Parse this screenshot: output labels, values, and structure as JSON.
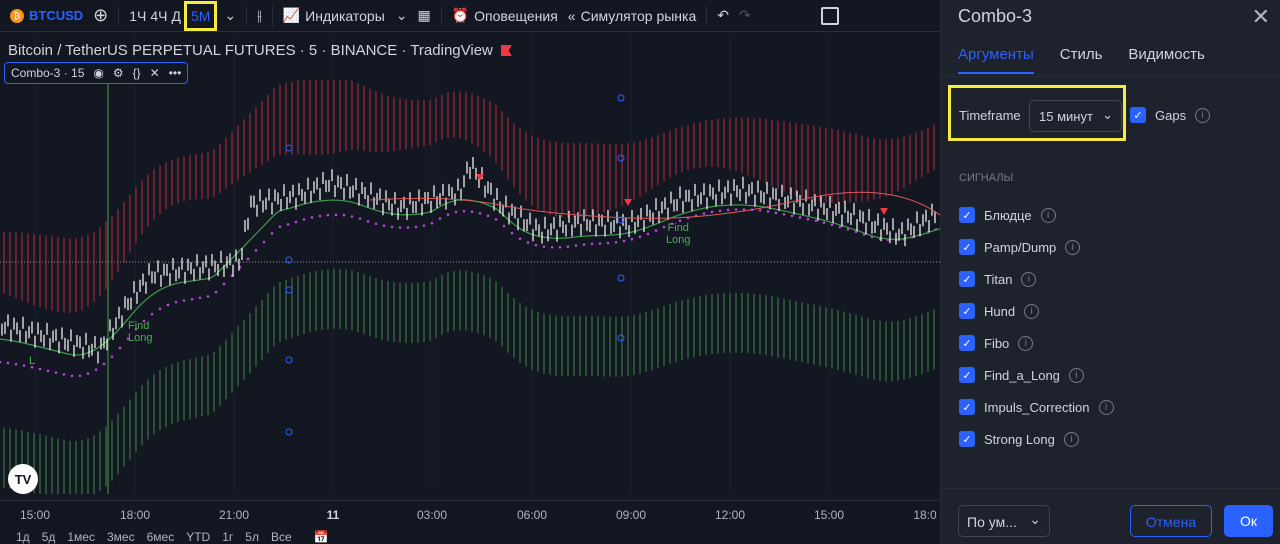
{
  "toolbar": {
    "symbol": "BTCUSD",
    "intervals": [
      "1Ч",
      "4Ч",
      "Д"
    ],
    "active_interval": "5M",
    "indicators": "Индикаторы",
    "alerts": "Оповещения",
    "replay": "Симулятор рынка"
  },
  "chart": {
    "title": "Bitcoin / TetherUS PERPETUAL FUTURES · 5 · BINANCE · TradingView",
    "indicator": "Combo-3 · 15",
    "labels": {
      "find_long_1": "Find",
      "find_long_2": "Long",
      "l": "L"
    },
    "time_axis": [
      "15:00",
      "18:00",
      "21:00",
      "11",
      "03:00",
      "06:00",
      "09:00",
      "12:00",
      "15:00",
      "18:0"
    ],
    "ranges": [
      "1д",
      "5д",
      "1мес",
      "3мес",
      "6мес",
      "YTD",
      "1г",
      "5л",
      "Все"
    ],
    "logo": "TV"
  },
  "panel": {
    "title": "Combo-3",
    "tabs": [
      "Аргументы",
      "Стиль",
      "Видимость"
    ],
    "timeframe_label": "Timeframe",
    "timeframe_value": "15 минут",
    "gaps": "Gaps",
    "section": "СИГНАЛЫ",
    "signals": [
      "Блюдце",
      "Pamp/Dump",
      "Titan",
      "Hund",
      "Fibo",
      "Find_a_Long",
      "Impuls_Correction",
      "Strong Long"
    ],
    "default": "По ум...",
    "cancel": "Отмена",
    "ok": "Ок"
  }
}
